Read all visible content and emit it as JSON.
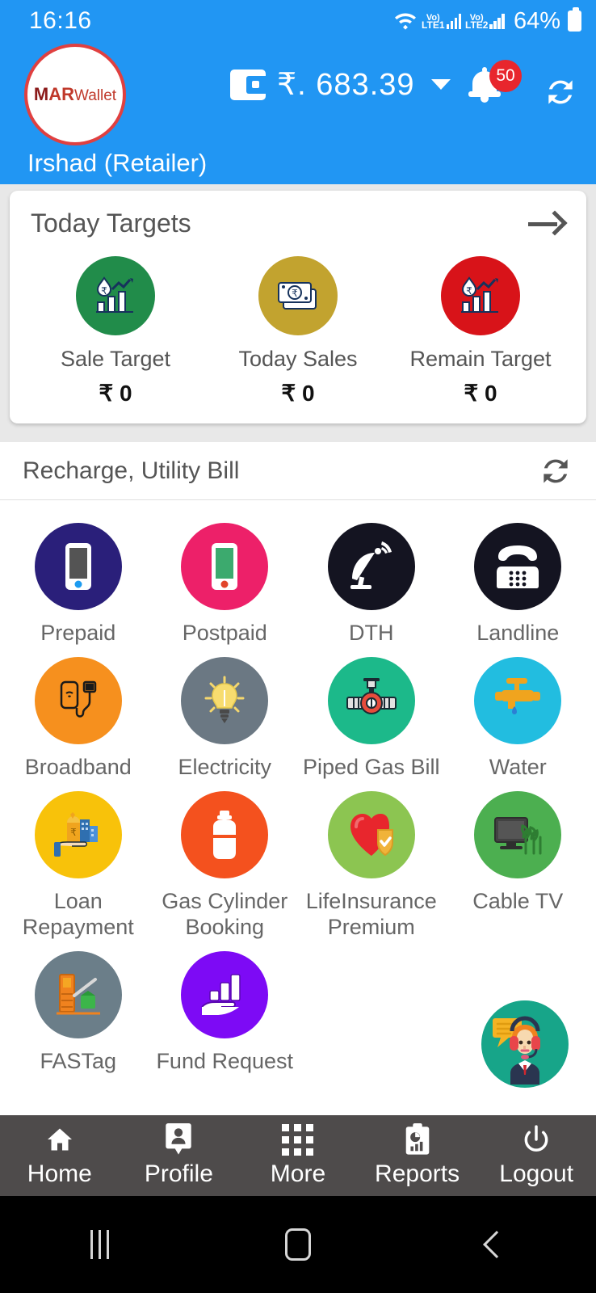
{
  "statusbar": {
    "time": "16:16",
    "wifi_icon": "wifi-icon",
    "sim1_label_top": "Vo)",
    "sim1_label_bottom": "LTE1",
    "sim2_label_top": "Vo)",
    "sim2_label_bottom": "LTE2",
    "battery": "64%"
  },
  "header": {
    "logo_m": "M",
    "logo_ar": "AR",
    "logo_wallet": "Wallet",
    "balance": "₹. 683.39",
    "notification_count": "50",
    "user_name": "Irshad (Retailer)",
    "accent_blue": "#2196f3",
    "badge_red": "#e8262d"
  },
  "targets": {
    "title": "Today Targets",
    "items": [
      {
        "label": "Sale Target",
        "value": "₹ 0",
        "color": "#218c4a"
      },
      {
        "label": "Today Sales",
        "value": "₹ 0",
        "color": "#c2a32f"
      },
      {
        "label": "Remain Target",
        "value": "₹ 0",
        "color": "#d81319"
      }
    ]
  },
  "recharge": {
    "title": "Recharge, Utility Bill",
    "refresh_icon": "refresh-icon",
    "tiles": [
      {
        "label": "Prepaid",
        "icon": "smartphone-icon",
        "color": "#2a1f7a"
      },
      {
        "label": "Postpaid",
        "icon": "smartphone-icon",
        "color": "#ed2069"
      },
      {
        "label": "DTH",
        "icon": "satellite-dish-icon",
        "color": "#141421"
      },
      {
        "label": "Landline",
        "icon": "telephone-icon",
        "color": "#141421"
      },
      {
        "label": "Broadband",
        "icon": "router-usb-icon",
        "color": "#f6901e"
      },
      {
        "label": "Electricity",
        "icon": "lightbulb-icon",
        "color": "#6b7883"
      },
      {
        "label": "Piped Gas Bill",
        "icon": "gas-pipe-valve-icon",
        "color": "#1cb98a"
      },
      {
        "label": "Water",
        "icon": "water-tap-icon",
        "color": "#22bde0"
      },
      {
        "label": "Loan Repayment",
        "icon": "money-hand-icon",
        "color": "#f8c20a"
      },
      {
        "label": "Gas Cylinder Booking",
        "icon": "gas-cylinder-icon",
        "color": "#f4511e"
      },
      {
        "label": "LifeInsurance Premium",
        "icon": "heart-shield-icon",
        "color": "#8cc551"
      },
      {
        "label": "Cable TV",
        "icon": "tv-antenna-icon",
        "color": "#4caf50"
      },
      {
        "label": "FASTag",
        "icon": "toll-barrier-icon",
        "color": "#6b7e89"
      },
      {
        "label": "Fund Request",
        "icon": "fund-hand-chart-icon",
        "color": "#7d0af5"
      }
    ]
  },
  "support": {
    "icon": "customer-support-agent-icon",
    "color": "#17a589"
  },
  "bottomnav": {
    "items": [
      {
        "label": "Home",
        "icon": "home-icon"
      },
      {
        "label": "Profile",
        "icon": "profile-icon"
      },
      {
        "label": "More",
        "icon": "grid-icon"
      },
      {
        "label": "Reports",
        "icon": "report-clipboard-icon"
      },
      {
        "label": "Logout",
        "icon": "power-icon"
      }
    ]
  },
  "androidnav": {
    "recents": "recents-icon",
    "home": "home-square-icon",
    "back": "back-chevron-icon"
  }
}
